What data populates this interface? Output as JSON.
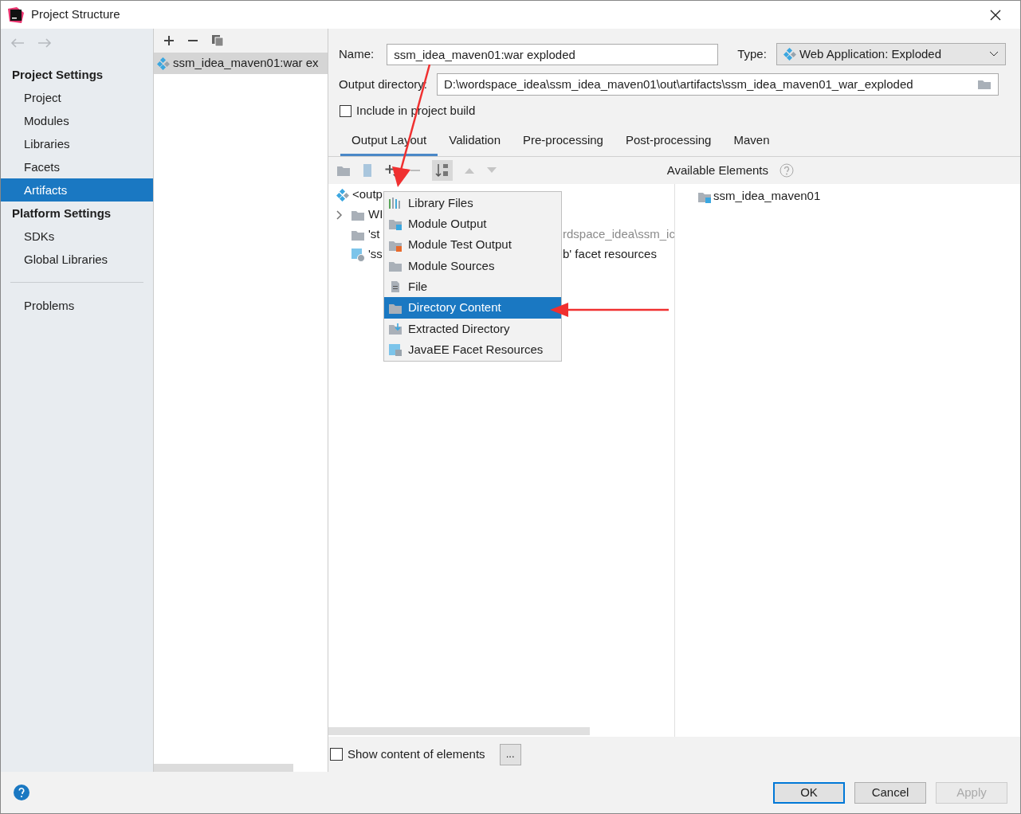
{
  "window": {
    "title": "Project Structure"
  },
  "sidebar": {
    "sections": [
      {
        "title": "Project Settings",
        "items": [
          {
            "label": "Project",
            "selected": false
          },
          {
            "label": "Modules",
            "selected": false
          },
          {
            "label": "Libraries",
            "selected": false
          },
          {
            "label": "Facets",
            "selected": false
          },
          {
            "label": "Artifacts",
            "selected": true
          }
        ]
      },
      {
        "title": "Platform Settings",
        "items": [
          {
            "label": "SDKs",
            "selected": false
          },
          {
            "label": "Global Libraries",
            "selected": false
          }
        ]
      }
    ],
    "problems": "Problems"
  },
  "artifacts": [
    {
      "label": "ssm_idea_maven01:war ex",
      "selected": true
    }
  ],
  "form": {
    "name_label": "Name:",
    "name_value": "ssm_idea_maven01:war exploded",
    "type_label": "Type:",
    "type_value": "Web Application: Exploded",
    "output_label": "Output directory:",
    "output_value": "D:\\wordspace_idea\\ssm_idea_maven01\\out\\artifacts\\ssm_idea_maven01_war_exploded",
    "include_label": "Include in project build",
    "include_checked": false
  },
  "tabs": [
    {
      "label": "Output Layout",
      "selected": true
    },
    {
      "label": "Validation",
      "selected": false
    },
    {
      "label": "Pre-processing",
      "selected": false
    },
    {
      "label": "Post-processing",
      "selected": false
    },
    {
      "label": "Maven",
      "selected": false
    }
  ],
  "available_title": "Available Elements",
  "tree": [
    {
      "kind": "root",
      "text": "<outp",
      "expandable": false
    },
    {
      "kind": "folder",
      "text": "WI",
      "expandable": true
    },
    {
      "kind": "dir",
      "text": "'st",
      "expandable": false,
      "tail": "rdspace_idea\\ssm_ic",
      "tail_muted": true
    },
    {
      "kind": "web",
      "text": "'ss",
      "expandable": false,
      "tail": "b' facet resources",
      "tail_muted": false
    }
  ],
  "available": [
    {
      "label": "ssm_idea_maven01"
    }
  ],
  "menu": [
    {
      "label": "Library Files",
      "kind": "library",
      "selected": false
    },
    {
      "label": "Module Output",
      "kind": "module",
      "selected": false
    },
    {
      "label": "Module Test Output",
      "kind": "test",
      "selected": false
    },
    {
      "label": "Module Sources",
      "kind": "sources",
      "selected": false
    },
    {
      "label": "File",
      "kind": "file",
      "selected": false
    },
    {
      "label": "Directory Content",
      "kind": "folder",
      "selected": true
    },
    {
      "label": "Extracted Directory",
      "kind": "extract",
      "selected": false
    },
    {
      "label": "JavaEE Facet Resources",
      "kind": "javaee",
      "selected": false
    }
  ],
  "show_content": {
    "label": "Show content of elements",
    "checked": false,
    "button": "..."
  },
  "buttons": [
    {
      "label": "OK",
      "kind": "default",
      "disabled": false
    },
    {
      "label": "Cancel",
      "kind": "normal",
      "disabled": false
    },
    {
      "label": "Apply",
      "kind": "normal",
      "disabled": true
    }
  ]
}
